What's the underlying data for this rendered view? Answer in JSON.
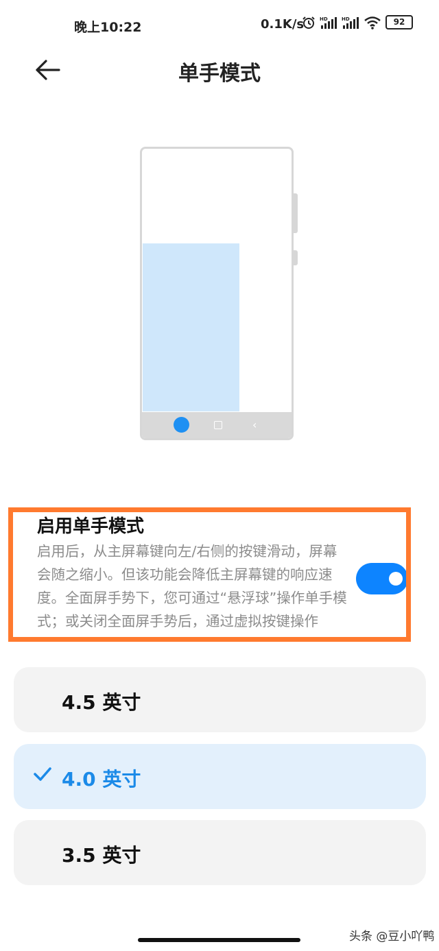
{
  "status_bar": {
    "time": "晚上10:22",
    "net_speed": "0.1K/s",
    "battery": "92",
    "icons": [
      "alarm-icon",
      "hd-signal-icon",
      "hd-signal-icon",
      "wifi-icon",
      "battery-icon"
    ]
  },
  "header": {
    "title": "单手模式",
    "back_icon": "arrow-left-icon"
  },
  "illustration": {
    "screen_color": "#cfe7fb",
    "accent": "#1e90f3"
  },
  "option": {
    "title": "启用单手模式",
    "description": "启用后，从主屏幕键向左/右侧的按键滑动，屏幕会随之缩小。但该功能会降低主屏幕键的响应速度。全面屏手势下，您可通过“悬浮球”操作单手模式；或关闭全面屏手势后，通过虚拟按键操作",
    "toggle_on": true
  },
  "sizes": [
    {
      "label": "4.5 英寸",
      "selected": false
    },
    {
      "label": "4.0 英寸",
      "selected": true
    },
    {
      "label": "3.5 英寸",
      "selected": false
    }
  ],
  "watermark": "头条 @豆小吖鸭",
  "colors": {
    "highlight_border": "#ff7a2f",
    "toggle": "#0d84ff",
    "selected_text": "#1b8ae8",
    "selected_bg": "#e3f0fc"
  }
}
